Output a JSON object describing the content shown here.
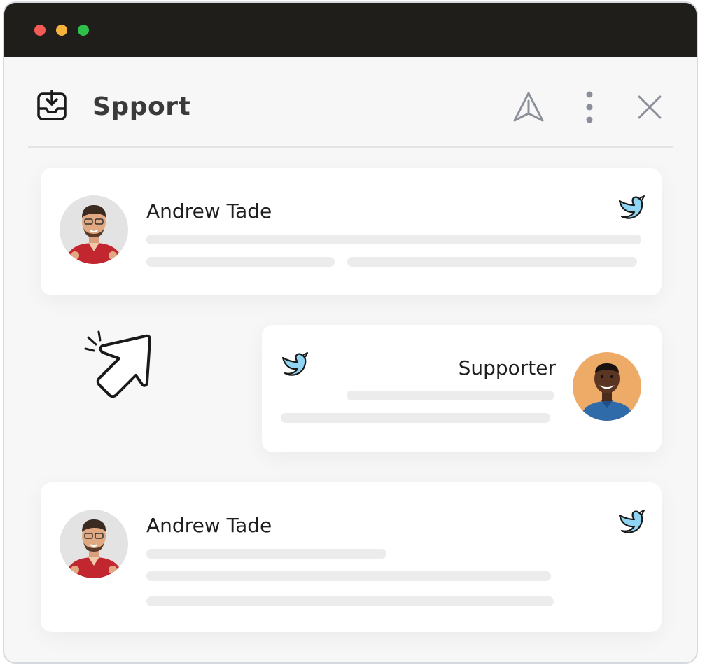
{
  "window": {
    "controls": [
      "close",
      "minimize",
      "zoom"
    ],
    "colors": {
      "titlebar": "#201e1b",
      "close": "#f25a55",
      "minimize": "#f6b53a",
      "zoom": "#2ec04a"
    }
  },
  "header": {
    "title": "Spport",
    "icons": [
      "inbox-download-icon",
      "send-icon",
      "more-vertical-icon",
      "close-icon"
    ]
  },
  "messages": [
    {
      "name": "Andrew Tade",
      "channel": "twitter-icon",
      "avatar_bg": "#e3e3e3",
      "shirt": "#c2262e"
    },
    {
      "name": "Supporter",
      "channel": "twitter-icon",
      "avatar_bg": "#eeaa67",
      "shirt": "#2f6aa9"
    },
    {
      "name": "Andrew Tade",
      "channel": "twitter-icon",
      "avatar_bg": "#e3e3e3",
      "shirt": "#c2262e"
    }
  ],
  "decor": {
    "cursor": "click-cursor-icon",
    "bird_color": "#8fd5f3"
  }
}
